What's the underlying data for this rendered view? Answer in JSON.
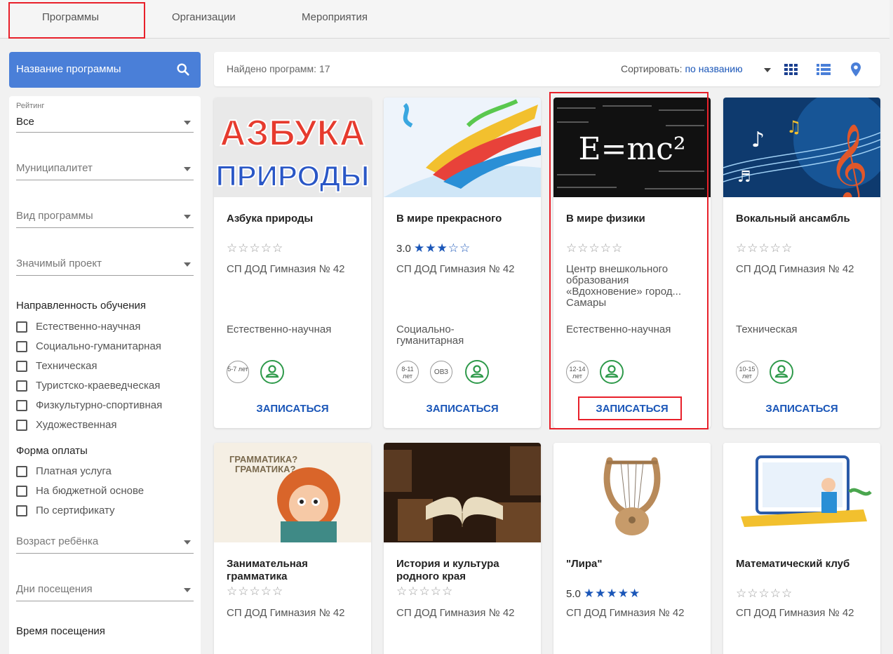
{
  "tabs": [
    {
      "label": "Программы"
    },
    {
      "label": "Организации"
    },
    {
      "label": "Мероприятия"
    }
  ],
  "sidebar": {
    "search_label": "Название программы",
    "rating": {
      "label": "Рейтинг",
      "value": "Все"
    },
    "municipality": "Муниципалитет",
    "program_type": "Вид программы",
    "project": "Значимый проект",
    "direction_title": "Направленность обучения",
    "directions": [
      "Естественно-научная",
      "Социально-гуманитарная",
      "Техническая",
      "Туристско-краеведческая",
      "Физкультурно-спортивная",
      "Художественная"
    ],
    "payment_title": "Форма оплаты",
    "payments": [
      "Платная услуга",
      "На бюджетной основе",
      "По сертификату"
    ],
    "child_age": "Возраст ребёнка",
    "days": "Дни посещения",
    "time_title": "Время посещения"
  },
  "results": {
    "found": "Найдено программ: 17",
    "sort_label": "Сортировать:",
    "sort_value": "по названию"
  },
  "cards": [
    {
      "title": "Азбука природы",
      "rating": "",
      "org": "СП ДОД Гимназия № 42",
      "direction": "Естественно-научная",
      "age": "5-7 лет",
      "ovz": "",
      "enroll": "ЗАПИСАТЬСЯ"
    },
    {
      "title": "В мире прекрасного",
      "rating": "3.0",
      "org": "СП ДОД Гимназия № 42",
      "direction": "Социально-гуманитарная",
      "age": "8-11 лет",
      "ovz": "ОВЗ",
      "enroll": "ЗАПИСАТЬСЯ"
    },
    {
      "title": "В мире физики",
      "rating": "",
      "org": "Центр внешкольного образования «Вдохновение» город... Самары",
      "direction": "Естественно-научная",
      "age": "12-14 лет",
      "ovz": "",
      "enroll": "ЗАПИСАТЬСЯ"
    },
    {
      "title": "Вокальный ансамбль",
      "rating": "",
      "org": "СП ДОД Гимназия № 42",
      "direction": "Техническая",
      "age": "10-15 лет",
      "ovz": "",
      "enroll": "ЗАПИСАТЬСЯ"
    },
    {
      "title": "Занимательная грамматика",
      "rating": "",
      "org": "СП ДОД Гимназия № 42",
      "image_text": "ГРАММАТИКА? ГРАМАТИКА?"
    },
    {
      "title": "История и культура родного края",
      "rating": "",
      "org": "СП ДОД Гимназия № 42"
    },
    {
      "title": "\"Лира\"",
      "rating": "5.0",
      "org": "СП ДОД Гимназия № 42"
    },
    {
      "title": "Математический клуб",
      "rating": "",
      "org": "СП ДОД Гимназия № 42"
    }
  ],
  "image_texts": {
    "azbuka_line1": "АЗБУКА",
    "azbuka_line2": "ПРИРОДЫ",
    "physics": "E=mc²",
    "grammar_line1": "ГРАММАТИКА?",
    "grammar_line2": "ГРАМАТИКА?"
  },
  "colors": {
    "accent": "#4a7fd8",
    "link": "#1a56b8",
    "star": "#1a56b8",
    "highlight": "#e8202a",
    "person": "#2f9a4b"
  }
}
